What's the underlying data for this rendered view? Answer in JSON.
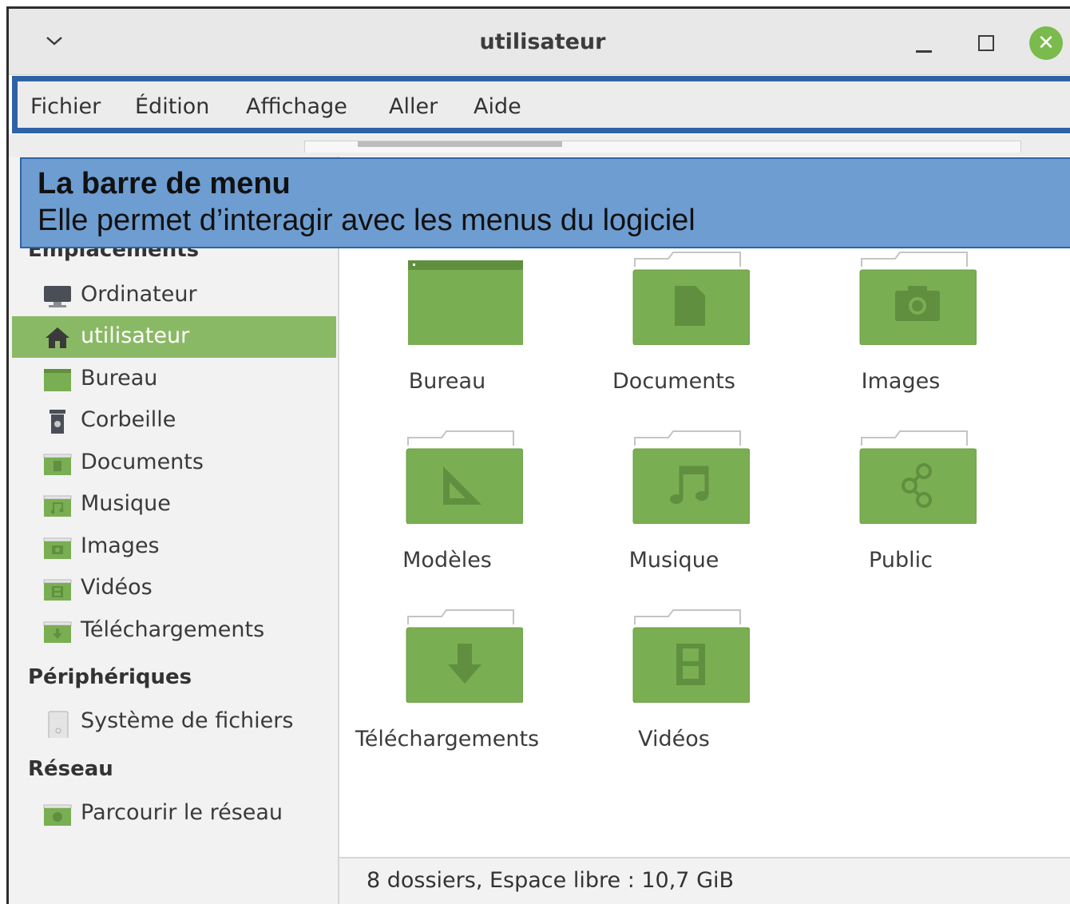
{
  "window": {
    "title": "utilisateur",
    "close_glyph": "✕"
  },
  "menubar": {
    "items": [
      "Fichier",
      "Édition",
      "Affichage",
      "Aller",
      "Aide"
    ]
  },
  "callout": {
    "title": "La barre de menu",
    "text": "Elle permet d’interagir avec les menus du logiciel"
  },
  "sidebar": {
    "sections": [
      {
        "heading": "Emplacements",
        "items": [
          {
            "label": "Ordinateur",
            "icon": "computer-icon"
          },
          {
            "label": "utilisateur",
            "icon": "home-icon",
            "active": true
          },
          {
            "label": "Bureau",
            "icon": "desktop-folder-icon"
          },
          {
            "label": "Corbeille",
            "icon": "trash-icon"
          },
          {
            "label": "Documents",
            "icon": "documents-folder-icon"
          },
          {
            "label": "Musique",
            "icon": "music-folder-icon"
          },
          {
            "label": "Images",
            "icon": "pictures-folder-icon"
          },
          {
            "label": "Vidéos",
            "icon": "videos-folder-icon"
          },
          {
            "label": "Téléchargements",
            "icon": "downloads-folder-icon"
          }
        ]
      },
      {
        "heading": "Périphériques",
        "items": [
          {
            "label": "Système de fichiers",
            "icon": "drive-icon"
          }
        ]
      },
      {
        "heading": "Réseau",
        "items": [
          {
            "label": "Parcourir le réseau",
            "icon": "network-folder-icon"
          }
        ]
      }
    ]
  },
  "folders": [
    {
      "label": "Bureau",
      "icon": "desktop-folder-icon"
    },
    {
      "label": "Documents",
      "icon": "documents-folder-icon"
    },
    {
      "label": "Images",
      "icon": "pictures-folder-icon"
    },
    {
      "label": "Modèles",
      "icon": "templates-folder-icon"
    },
    {
      "label": "Musique",
      "icon": "music-folder-icon"
    },
    {
      "label": "Public",
      "icon": "public-folder-icon"
    },
    {
      "label": "Téléchargements",
      "icon": "downloads-folder-icon"
    },
    {
      "label": "Vidéos",
      "icon": "videos-folder-icon"
    }
  ],
  "status": {
    "text": "8 dossiers, Espace libre : 10,7 GiB"
  },
  "colors": {
    "folder_green": "#7aae52",
    "folder_dark": "#5f8f3f",
    "sidebar_active": "#8ab965",
    "menubar_highlight": "#2f63a6",
    "callout_bg": "#6e9dd1"
  }
}
